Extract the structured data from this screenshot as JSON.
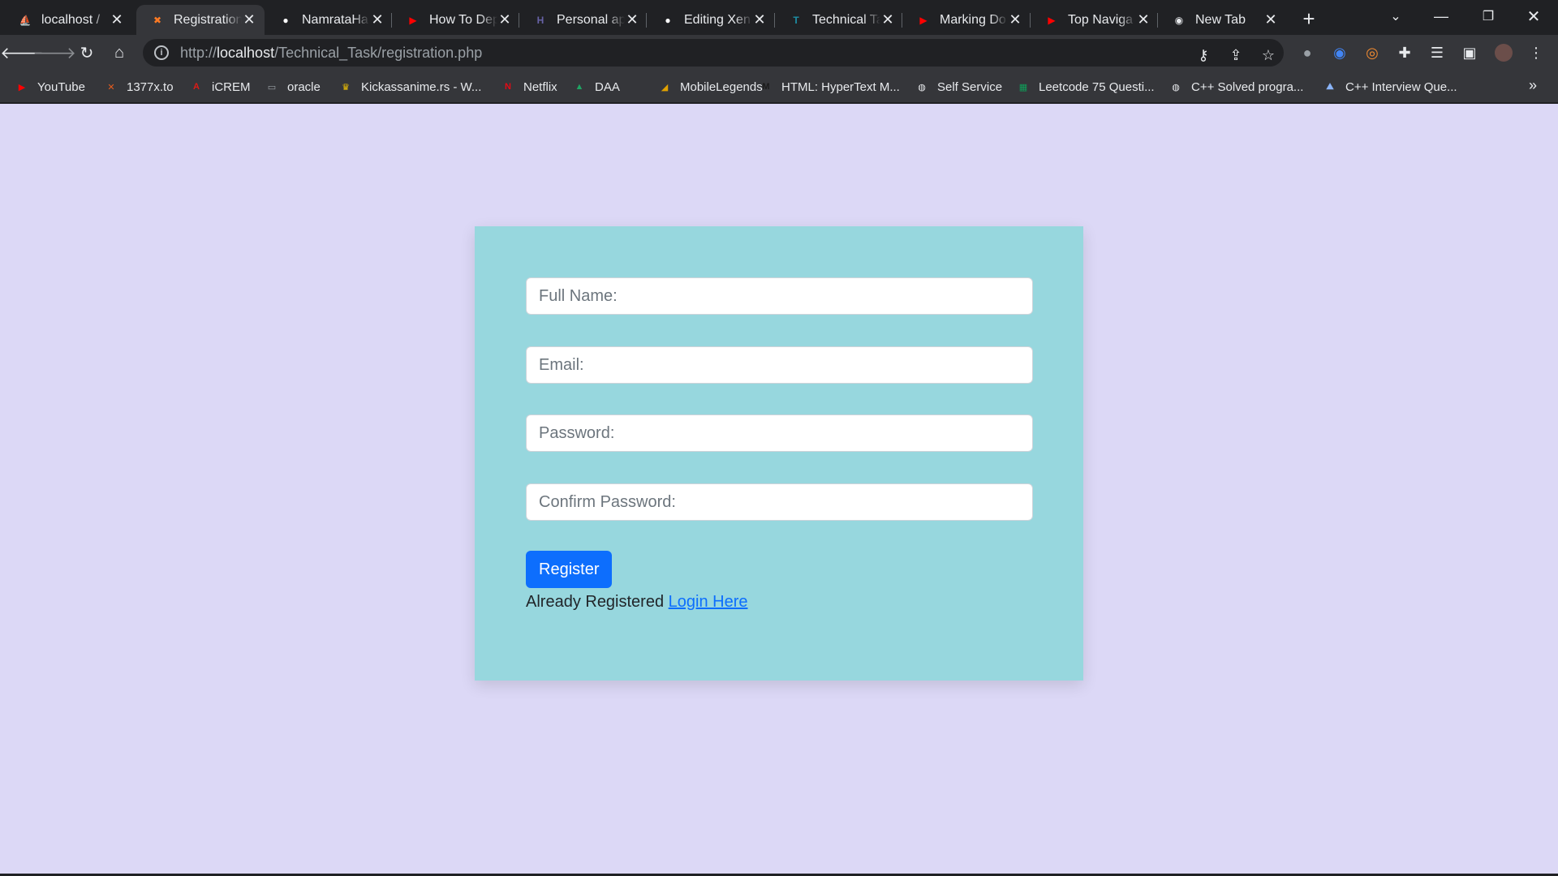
{
  "browser": {
    "tabs": [
      {
        "title": "localhost / ",
        "icon": "phpmyadmin-icon",
        "color": "#f89c0e",
        "active": false
      },
      {
        "title": "Registration",
        "icon": "xampp-icon",
        "color": "#fb7a24",
        "active": true
      },
      {
        "title": "NamrataHa",
        "icon": "github-icon",
        "color": "#ffffff",
        "active": false
      },
      {
        "title": "How To Dep",
        "icon": "youtube-icon",
        "color": "#ff0000",
        "active": false
      },
      {
        "title": "Personal ap",
        "icon": "heroku-icon",
        "color": "#6762a6",
        "active": false
      },
      {
        "title": "Editing Xen",
        "icon": "github-icon",
        "color": "#ffffff",
        "active": false
      },
      {
        "title": "Technical Ta",
        "icon": "teams-icon",
        "color": "#1d8fa6",
        "active": false
      },
      {
        "title": "Marking Do",
        "icon": "youtube-icon",
        "color": "#ff0000",
        "active": false
      },
      {
        "title": "Top Naviga",
        "icon": "youtube-icon",
        "color": "#ff0000",
        "active": false
      },
      {
        "title": "New Tab",
        "icon": "chrome-icon",
        "color": "#e8eaed",
        "active": false
      }
    ],
    "url_scheme": "http://",
    "url_host": "localhost",
    "url_path": "/Technical_Task/registration.php",
    "bookmarks": [
      {
        "label": "YouTube",
        "icon": "youtube-icon",
        "color": "#ff0000"
      },
      {
        "label": "1377x.to",
        "icon": "x-icon",
        "color": "#e65c1e"
      },
      {
        "label": "iCREM",
        "icon": "angular-icon",
        "color": "#dd1b16"
      },
      {
        "label": "oracle",
        "icon": "folder-icon",
        "color": "#9aa0a6"
      },
      {
        "label": "Kickassanime.rs - W...",
        "icon": "crown-icon",
        "color": "#f2c300"
      },
      {
        "label": "Netflix",
        "icon": "netflix-icon",
        "color": "#e50914"
      },
      {
        "label": "DAA",
        "icon": "drive-icon",
        "color": "#1fa463"
      },
      {
        "label": "MobileLegends",
        "icon": "mobilelegends-icon",
        "color": "#e0a100"
      },
      {
        "label": "HTML: HyperText M...",
        "icon": "mdn-icon",
        "color": "#1b1b1b"
      },
      {
        "label": "Self Service",
        "icon": "globe-icon",
        "color": "#e8eaed"
      },
      {
        "label": "Leetcode 75 Questi...",
        "icon": "sheets-icon",
        "color": "#0f9d58"
      },
      {
        "label": "C++ Solved progra...",
        "icon": "globe-icon",
        "color": "#e8eaed"
      },
      {
        "label": "C++ Interview Que...",
        "icon": "mountain-icon",
        "color": "#8ab4f8"
      }
    ]
  },
  "form": {
    "fullname_placeholder": "Full Name:",
    "email_placeholder": "Email:",
    "password_placeholder": "Password:",
    "confirm_placeholder": "Confirm Password:",
    "submit_label": "Register",
    "already_text": "Already Registered",
    "login_link": "Login Here"
  },
  "colors": {
    "page_bg": "#dcd8f6",
    "card_bg": "#97d7de",
    "button": "#0d6efd",
    "link": "#0d6efd"
  }
}
